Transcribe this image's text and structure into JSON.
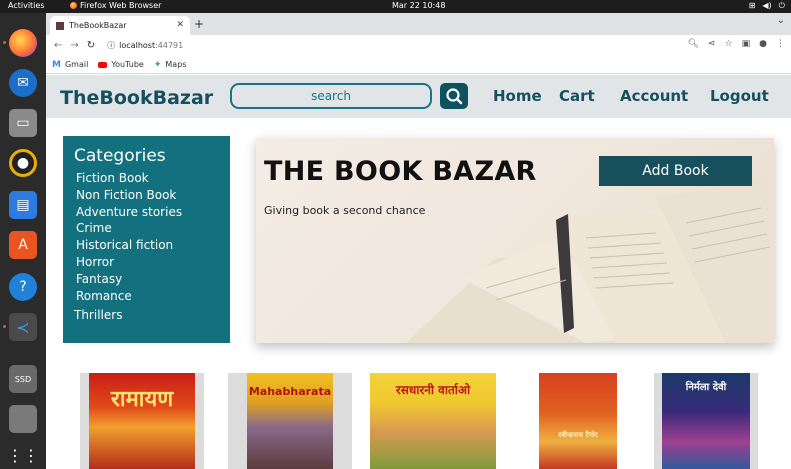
{
  "os": {
    "activities": "Activities",
    "app_name": "Firefox Web Browser",
    "clock": "Mar 22  10:48"
  },
  "browser": {
    "tab_title": "TheBookBazar",
    "url_host": "localhost",
    "url_port": ":44791",
    "bookmarks": [
      "Gmail",
      "YouTube",
      "Maps"
    ]
  },
  "header": {
    "brand": "TheBookBazar",
    "search_placeholder": "search",
    "nav": [
      "Home",
      "Cart",
      "Account",
      "Logout"
    ]
  },
  "sidebar": {
    "title": "Categories",
    "items": [
      "Fiction Book",
      "Non Fiction Book",
      "Adventure stories",
      "Crime",
      "Historical fiction",
      "Horror",
      "Fantasy",
      "Romance",
      "Thrillers"
    ]
  },
  "hero": {
    "title": "THE BOOK BAZAR",
    "subtitle": "Giving book a second chance",
    "add_button": "Add Book"
  },
  "books": [
    {
      "cover_text": "रामायण"
    },
    {
      "cover_text": "Mahabharata"
    },
    {
      "cover_text": "रसधारनी वार्ताओ"
    },
    {
      "cover_text": "रवीन्द्रनाथ टैगोर"
    },
    {
      "cover_text": "निर्मला देवी"
    }
  ]
}
